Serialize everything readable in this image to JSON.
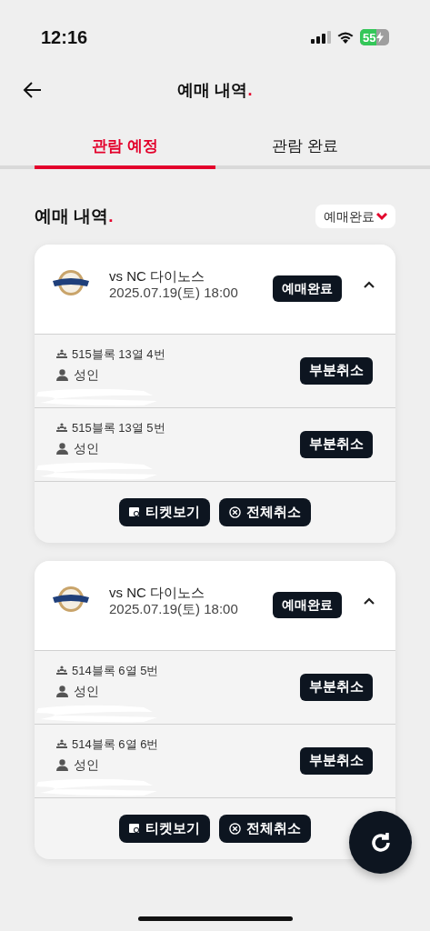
{
  "status_bar": {
    "time": "12:16",
    "battery": "55",
    "charging": true
  },
  "header": {
    "title": "예매 내역",
    "accent": "."
  },
  "tabs": [
    {
      "label": "관람 예정",
      "selected": true
    },
    {
      "label": "관람 완료",
      "selected": false
    }
  ],
  "section": {
    "title": "예매 내역",
    "accent": ".",
    "filter": "예매완료"
  },
  "bookings": [
    {
      "opponent": "vs NC 다이노스",
      "datetime": "2025.07.19(토) 18:00",
      "status": "예매완료",
      "expanded": true,
      "seats": [
        {
          "seat": "515블록 13열 4번",
          "type": "성인",
          "action": "부분취소",
          "redacted": true
        },
        {
          "seat": "515블록 13열 5번",
          "type": "성인",
          "action": "부분취소",
          "redacted": true
        }
      ],
      "buttons": [
        {
          "kind": "ticket",
          "label": "티켓보기"
        },
        {
          "kind": "cancel",
          "label": "전체취소"
        }
      ]
    },
    {
      "opponent": "vs NC 다이노스",
      "datetime": "2025.07.19(토) 18:00",
      "status": "예매완료",
      "expanded": true,
      "seats": [
        {
          "seat": "514블록 6열 5번",
          "type": "성인",
          "action": "부분취소",
          "redacted": true
        },
        {
          "seat": "514블록 6열 6번",
          "type": "성인",
          "action": "부분취소",
          "redacted": true
        }
      ],
      "buttons": [
        {
          "kind": "ticket",
          "label": "티켓보기"
        },
        {
          "kind": "cancel",
          "label": "전체취소"
        }
      ]
    }
  ]
}
